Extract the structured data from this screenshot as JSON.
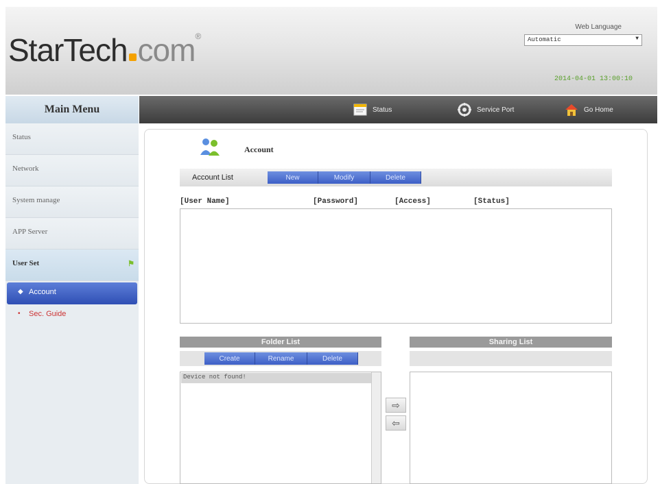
{
  "header": {
    "logo_main": "StarTech",
    "logo_suffix": "com",
    "logo_reg": "®",
    "language_label": "Web Language",
    "language_value": "Automatic",
    "datetime": "2014-04-01 13:00:10"
  },
  "nav": {
    "items": [
      {
        "label": "Status",
        "icon": "status-icon"
      },
      {
        "label": "Service Port",
        "icon": "service-port-icon"
      },
      {
        "label": "Go Home",
        "icon": "home-icon"
      }
    ]
  },
  "sidebar": {
    "title": "Main Menu",
    "items": [
      {
        "label": "Status"
      },
      {
        "label": "Network"
      },
      {
        "label": "System manage"
      },
      {
        "label": "APP Server"
      },
      {
        "label": "User Set"
      }
    ],
    "subitems": [
      {
        "label": "Account"
      },
      {
        "label": "Sec. Guide"
      }
    ]
  },
  "account": {
    "title": "Account",
    "list_label": "Account List",
    "buttons": [
      "New",
      "Modify",
      "Delete"
    ],
    "columns": [
      "[User Name]",
      "[Password]",
      "[Access]",
      "[Status]"
    ]
  },
  "folder": {
    "title": "Folder List",
    "buttons": [
      "Create",
      "Rename",
      "Delete"
    ],
    "rows": [
      "Device not found!"
    ]
  },
  "sharing": {
    "title": "Sharing List"
  },
  "transfer": {
    "right_arrow": "⇨",
    "left_arrow": "⇦"
  },
  "colors": {
    "accent_blue": "#3d5fc6",
    "logo_dot": "#f4a100",
    "datetime_green": "#5aa02c",
    "sub_item_red": "#cc3333"
  }
}
